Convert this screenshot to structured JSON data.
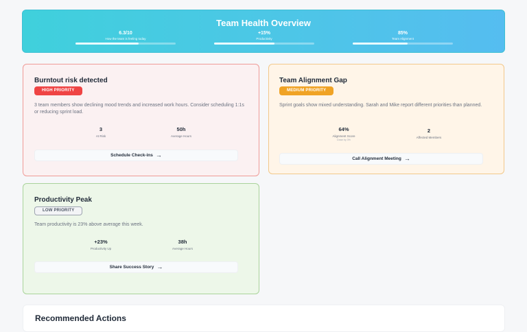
{
  "hero": {
    "title": "Team Health Overview",
    "metrics": [
      {
        "value": "6.3/10",
        "label": "How the team is feeling today",
        "progress": 0.63
      },
      {
        "value": "+15%",
        "label": "Productivity",
        "progress": 0.6
      },
      {
        "value": "85%",
        "label": "Team Alignment",
        "progress": 0.55
      }
    ]
  },
  "cards": {
    "burnout": {
      "title": "Burntout risk detected",
      "priority": "HIGH PRIORITY",
      "description": "3 team members show declining mood trends and increased work hours. Consider scheduling 1:1s or reducing sprint load.",
      "stats": [
        {
          "value": "3",
          "label": "At Risk"
        },
        {
          "value": "50h",
          "label": "Average Hours"
        }
      ],
      "action": "Schedule Check-ins"
    },
    "alignment": {
      "title": "Team Alignment Gap",
      "priority": "MEDIUM PRIORITY",
      "description": "Sprint goals show mixed understanding. Sarah and Mike report different priorities than planned.",
      "stats": [
        {
          "value": "64%",
          "label": "Alignment Score",
          "note": "Down by 3%"
        },
        {
          "value": "2",
          "label": "Affected Members"
        }
      ],
      "action": "Call Alignment Meeting"
    },
    "productivity": {
      "title": "Productivity Peak",
      "priority": "LOW PRIORITY",
      "description": "Team productivity is 23% above average this week.",
      "stats": [
        {
          "value": "+23%",
          "label": "Productivity Up"
        },
        {
          "value": "38h",
          "label": "Average Hours"
        }
      ],
      "action": "Share Success Story"
    }
  },
  "recommended": {
    "title": "Recommended Actions"
  },
  "icons": {
    "action_arrow": "arrow-right-icon"
  },
  "colors": {
    "high": "#ef4444",
    "medium": "#f0a325",
    "hero_start": "#3fd0dc",
    "hero_end": "#55bdf0"
  }
}
